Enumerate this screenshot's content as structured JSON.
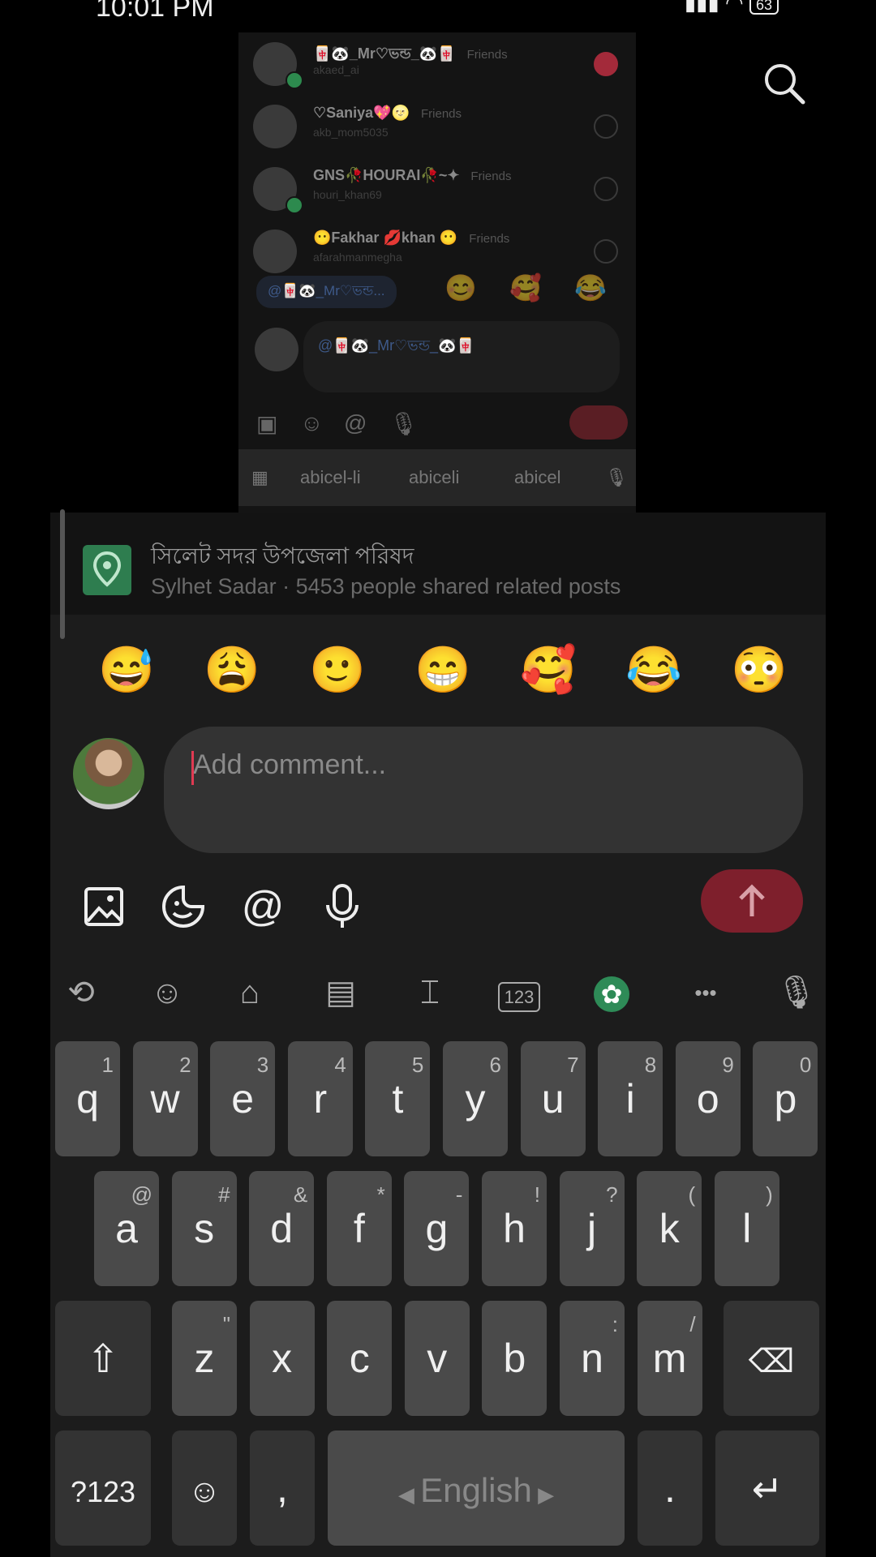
{
  "status": {
    "time": "10:01 PM",
    "battery": "63"
  },
  "preview": {
    "rows": [
      {
        "name": "🀄🐼_Mr♡ভন্ড_🐼🀄",
        "tag": "Friends",
        "handle": "akaed_ai",
        "checked": true,
        "online": true
      },
      {
        "name": "♡Saniya💖🌝",
        "tag": "Friends",
        "handle": "akb_mom5035",
        "checked": false,
        "online": false
      },
      {
        "name": "GNS🥀HOURAI🥀~✦",
        "tag": "Friends",
        "handle": "houri_khan69",
        "checked": false,
        "online": true
      },
      {
        "name": "😶Fakhar 💋khan 😶",
        "tag": "Friends",
        "handle": "afarahmanmegha",
        "checked": false,
        "online": false
      }
    ],
    "mention_chip": "@🀄🐼_Mr♡ভন্ড...",
    "emojis": [
      "😊",
      "🥰",
      "😂"
    ],
    "input_text": "@🀄🐼_Mr♡ভন্ড_🐼🀄",
    "suggestions": [
      "abicel-li",
      "abiceli",
      "abicel"
    ]
  },
  "place": {
    "title": "সিলেট সদর উপজেলা পরিষদ",
    "subtitle": "Sylhet Sadar · 5453 people shared related posts"
  },
  "emoji_bar": [
    "😅",
    "😩",
    "🙂",
    "😁",
    "🥰",
    "😂",
    "😳"
  ],
  "comment": {
    "placeholder": "Add comment..."
  },
  "toolbar_icons": [
    "image-icon",
    "sticker-icon",
    "mention-icon",
    "microphone-icon"
  ],
  "keyboard": {
    "tools": [
      "translate-icon",
      "emoji-icon",
      "store-icon",
      "clipboard-icon",
      "text-edit-icon",
      "numpad-icon",
      "theme-icon",
      "more-icon",
      "voice-icon"
    ],
    "numpad_label": "123",
    "row1": [
      [
        "q",
        "1"
      ],
      [
        "w",
        "2"
      ],
      [
        "e",
        "3"
      ],
      [
        "r",
        "4"
      ],
      [
        "t",
        "5"
      ],
      [
        "y",
        "6"
      ],
      [
        "u",
        "7"
      ],
      [
        "i",
        "8"
      ],
      [
        "o",
        "9"
      ],
      [
        "p",
        "0"
      ]
    ],
    "row2": [
      [
        "a",
        "@"
      ],
      [
        "s",
        "#"
      ],
      [
        "d",
        "&"
      ],
      [
        "f",
        "*"
      ],
      [
        "g",
        "-"
      ],
      [
        "h",
        "!"
      ],
      [
        "j",
        "?"
      ],
      [
        "k",
        "("
      ],
      [
        "l",
        ")"
      ]
    ],
    "row3": [
      [
        "z",
        "\""
      ],
      [
        "x",
        ""
      ],
      [
        "c",
        ""
      ],
      [
        "v",
        ""
      ],
      [
        "b",
        ""
      ],
      [
        "n",
        ":"
      ],
      [
        "m",
        "/"
      ]
    ],
    "symbols_label": "?123",
    "comma": ",",
    "space_label": "English",
    "period": ".",
    "more_dots": "•••"
  },
  "colors": {
    "accent": "#7e1f2c",
    "caret": "#e03a52"
  }
}
